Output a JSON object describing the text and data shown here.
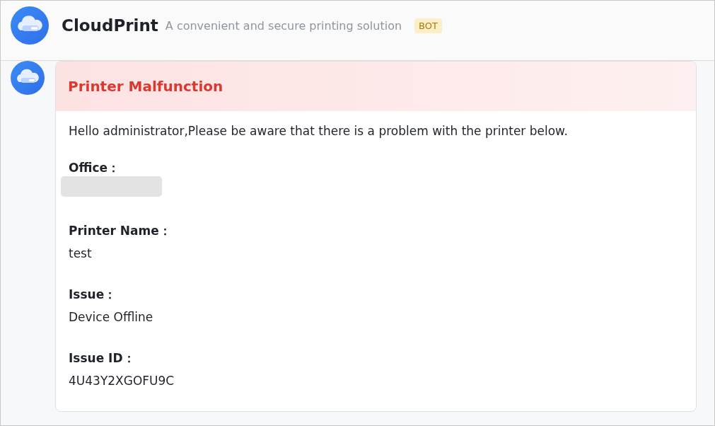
{
  "header": {
    "title": "CloudPrint",
    "subtitle": "A convenient and secure printing solution",
    "badge": "BOT"
  },
  "card": {
    "title": "Printer Malfunction",
    "greeting": "Hello administrator,Please be aware that there is a problem with the printer below.",
    "fields": [
      {
        "label": "Office：",
        "redacted": true
      },
      {
        "label": "Printer Name：",
        "value": "test",
        "redacted": false
      },
      {
        "label": "Issue：",
        "value": "Device Offline",
        "redacted": false
      },
      {
        "label": "Issue ID：",
        "value": "4U43Y2XGOFU9C",
        "redacted": false
      }
    ]
  }
}
